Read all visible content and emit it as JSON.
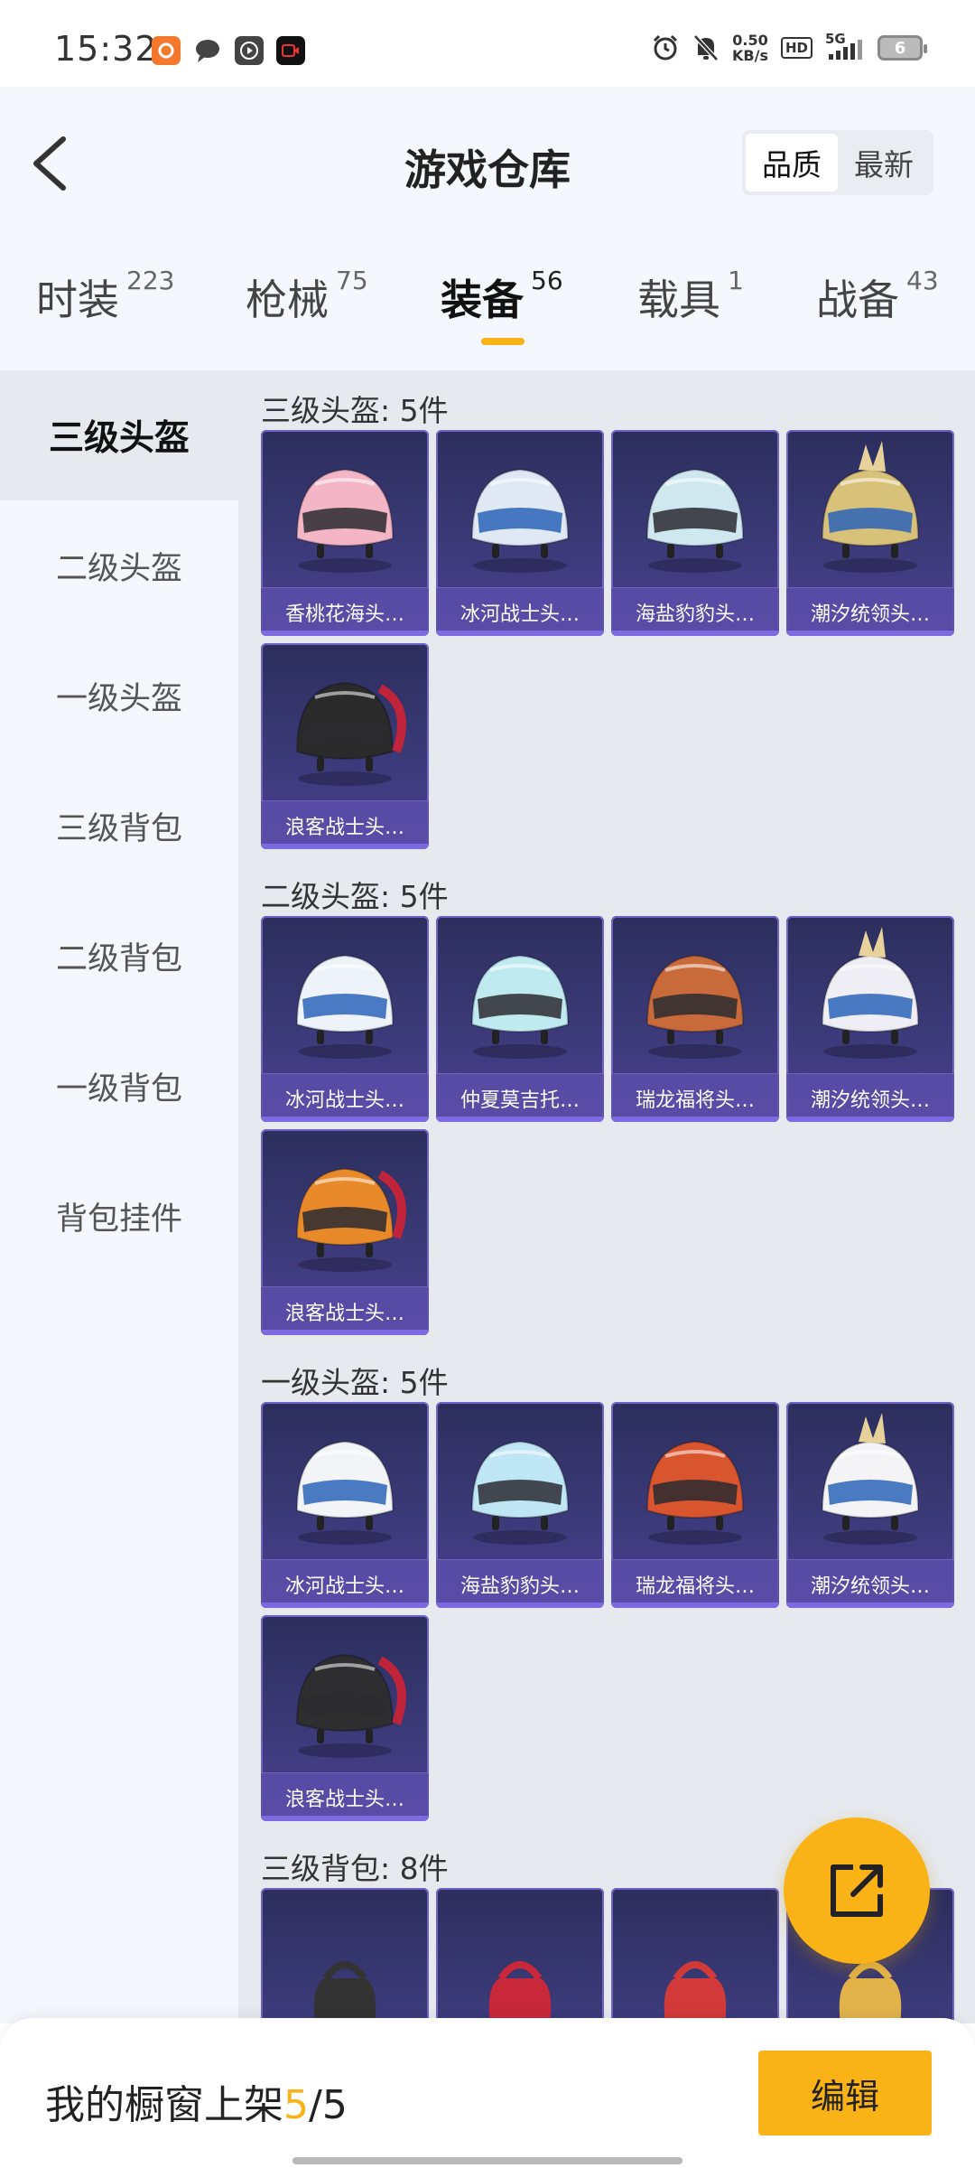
{
  "status": {
    "time": "15:32",
    "speed_value": "0.50",
    "speed_unit": "KB/s",
    "hd": "HD",
    "network": "5G",
    "battery": "6"
  },
  "header": {
    "title": "游戏仓库",
    "sort_quality": "品质",
    "sort_newest": "最新"
  },
  "tabs": [
    {
      "label": "时装",
      "count": "223"
    },
    {
      "label": "枪械",
      "count": "75"
    },
    {
      "label": "装备",
      "count": "56"
    },
    {
      "label": "载具",
      "count": "1"
    },
    {
      "label": "战备",
      "count": "43"
    }
  ],
  "sidebar": [
    "三级头盔",
    "二级头盔",
    "一级头盔",
    "三级背包",
    "二级背包",
    "一级背包",
    "背包挂件"
  ],
  "sections": [
    {
      "title": "三级头盔: 5件",
      "items": [
        {
          "name": "香桃花海头…",
          "icon": "pink-helmet",
          "color": "#f4b6c6"
        },
        {
          "name": "冰河战士头…",
          "icon": "blue-helmet",
          "color": "#dfe8f4"
        },
        {
          "name": "海盐豹豹头…",
          "icon": "seal-helmet",
          "color": "#cfe8f0"
        },
        {
          "name": "潮汐统领头…",
          "icon": "tide-helmet",
          "color": "#d8c27a"
        },
        {
          "name": "浪客战士头…",
          "icon": "ronin-helmet",
          "color": "#2a2a2a"
        }
      ]
    },
    {
      "title": "二级头盔: 5件",
      "items": [
        {
          "name": "冰河战士头…",
          "icon": "blue-helmet",
          "color": "#eef3fa"
        },
        {
          "name": "仲夏莫吉托…",
          "icon": "mint-helmet",
          "color": "#bfeaf0"
        },
        {
          "name": "瑞龙福将头…",
          "icon": "dragon-helmet",
          "color": "#c96a3a"
        },
        {
          "name": "潮汐统领头…",
          "icon": "tide-helmet",
          "color": "#eeeef4"
        },
        {
          "name": "浪客战士头…",
          "icon": "ronin-helmet",
          "color": "#e88a2a"
        }
      ]
    },
    {
      "title": "一级头盔: 5件",
      "items": [
        {
          "name": "冰河战士头…",
          "icon": "blue-helmet",
          "color": "#f2f4f8"
        },
        {
          "name": "海盐豹豹头…",
          "icon": "seal-helmet",
          "color": "#bfe6f4"
        },
        {
          "name": "瑞龙福将头…",
          "icon": "dragon-helmet",
          "color": "#d9552e"
        },
        {
          "name": "潮汐统领头…",
          "icon": "tide-helmet",
          "color": "#f4f4f6"
        },
        {
          "name": "浪客战士头…",
          "icon": "ronin-helmet",
          "color": "#2e2e30"
        }
      ]
    },
    {
      "title": "三级背包: 8件",
      "items": [
        {
          "name": "",
          "icon": "backpack",
          "color": "#333333"
        },
        {
          "name": "",
          "icon": "backpack",
          "color": "#c8283a"
        },
        {
          "name": "",
          "icon": "backpack",
          "color": "#d23a3a"
        },
        {
          "name": "",
          "icon": "backpack",
          "color": "#e2b34a"
        }
      ]
    }
  ],
  "bottom": {
    "shelf_label": "我的橱窗上架",
    "shelf_used": "5",
    "shelf_sep": "/",
    "shelf_total": "5",
    "edit_label": "编辑"
  },
  "colors": {
    "accent": "#f9b316",
    "card_top": "#2c2e5c",
    "card_bottom": "#4d3f93"
  }
}
